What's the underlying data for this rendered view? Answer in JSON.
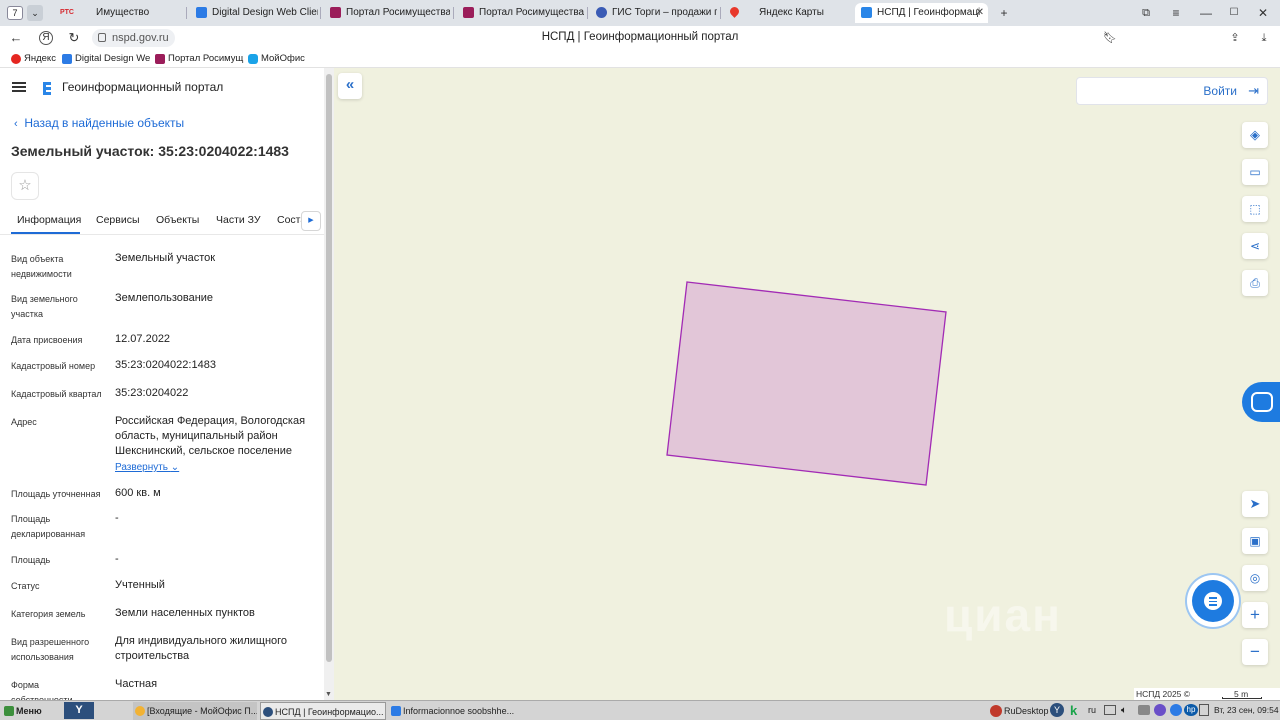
{
  "browser": {
    "tab_count": "7",
    "tabs": [
      {
        "label": "Имущество",
        "icon": "rts-icon"
      },
      {
        "label": "Digital Design Web Client",
        "icon": "digital-design-icon"
      },
      {
        "label": "Портал Росимущества",
        "icon": "rosim-icon"
      },
      {
        "label": "Портал Росимущества",
        "icon": "rosim-icon"
      },
      {
        "label": "ГИС Торги – продажи гос",
        "icon": "gis-torgi-icon"
      },
      {
        "label": "Яндекс Карты",
        "icon": "yandex-maps-icon"
      },
      {
        "label": "НСПД | Геоинформаці",
        "icon": "nspd-icon"
      }
    ],
    "tab_icon_text": "РТС",
    "new_tab": "+",
    "url": "nspd.gov.ru",
    "page_title": "НСПД | Геоинформационный портал",
    "bookmarks": [
      {
        "label": "Яндекс",
        "color": "#e52620"
      },
      {
        "label": "Digital Design We",
        "color": "#2c7be5"
      },
      {
        "label": "Портал Росимущ",
        "color": "#9b1d5a"
      },
      {
        "label": "МойОфис",
        "color": "#1aa3e8"
      }
    ]
  },
  "panel": {
    "app_title": "Геоинформационный портал",
    "back_link": "Назад в найденные объекты",
    "object_title": "Земельный участок: 35:23:0204022:1483",
    "star": "☆",
    "tabs": [
      "Информация",
      "Сервисы",
      "Объекты",
      "Части ЗУ",
      "Соста"
    ],
    "fields": [
      {
        "label": "Вид объекта недвижимости",
        "value": "Земельный участок"
      },
      {
        "label": "Вид земельного участка",
        "value": "Землепользование"
      },
      {
        "label": "Дата присвоения",
        "value": "12.07.2022"
      },
      {
        "label": "Кадастровый номер",
        "value": "35:23:0204022:1483"
      },
      {
        "label": "Кадастровый квартал",
        "value": "35:23:0204022"
      },
      {
        "label": "Адрес",
        "value": "Российская Федерация, Вологодская область, муниципальный район Шекснинский, сельское поселение"
      },
      {
        "label": "Площадь уточненная",
        "value": "600 кв. м"
      },
      {
        "label": "Площадь декларированная",
        "value": "-"
      },
      {
        "label": "Площадь",
        "value": "-"
      },
      {
        "label": "Статус",
        "value": "Учтенный"
      },
      {
        "label": "Категория земель",
        "value": "Земли населенных пунктов"
      },
      {
        "label": "Вид разрешенного использования",
        "value": "Для индивидуального жилищного строительства"
      },
      {
        "label": "Форма собственности",
        "value": "Частная"
      }
    ],
    "expand_label": "Развернуть"
  },
  "map": {
    "login_label": "Войти",
    "collapse": "«",
    "watermark": "циан",
    "copyright": "НСПД 2025 ©",
    "scale_label": "5 m",
    "parcel_fill": "#e2c6d8",
    "parcel_stroke": "#a22bb5",
    "zoom_in": "+",
    "zoom_out": "−"
  },
  "taskbar": {
    "start": "Меню",
    "items": [
      "[Входящие - МойОфис П...",
      "НСПД | Геоинформацио...",
      "Informacionnoe soobshhe..."
    ],
    "tray_app": "RuDesktop",
    "lang": "ru",
    "clock": "Вт, 23 сен, 09:54"
  }
}
